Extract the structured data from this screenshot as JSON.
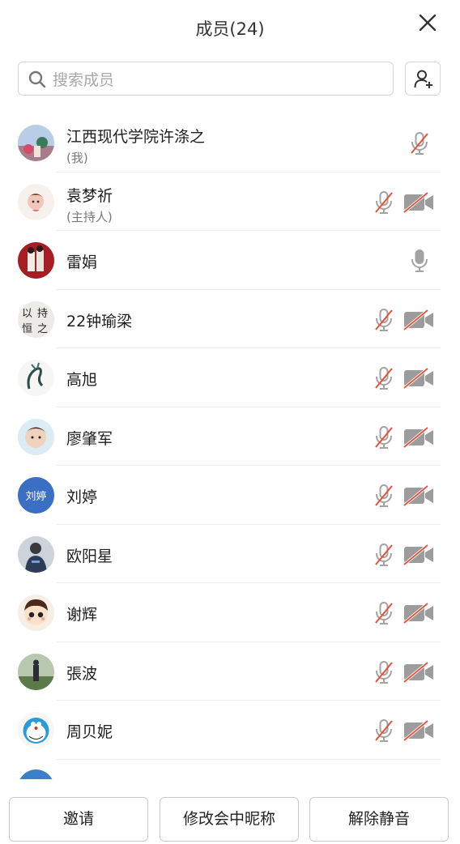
{
  "header": {
    "title": "成员(24)"
  },
  "search": {
    "placeholder": "搜索成员"
  },
  "members": [
    {
      "name": "江西现代学院许涤之",
      "sub": "(我)",
      "mic": "muted",
      "cam": "none",
      "avatar": "photo-festival"
    },
    {
      "name": "袁梦祈",
      "sub": "(主持人)",
      "mic": "muted",
      "cam": "off",
      "avatar": "photo-doll"
    },
    {
      "name": "雷娟",
      "sub": "",
      "mic": "on",
      "cam": "none",
      "avatar": "photo-red"
    },
    {
      "name": "22钟瑜梁",
      "sub": "",
      "mic": "muted",
      "cam": "off",
      "avatar": "calligraphy",
      "avatar_text": [
        "以",
        "持",
        "恒",
        "之"
      ]
    },
    {
      "name": "高旭",
      "sub": "",
      "mic": "muted",
      "cam": "off",
      "avatar": "ink-dragon"
    },
    {
      "name": "廖肇军",
      "sub": "",
      "mic": "muted",
      "cam": "off",
      "avatar": "photo-child"
    },
    {
      "name": "刘婷",
      "sub": "",
      "mic": "muted",
      "cam": "off",
      "avatar": "text",
      "avatar_text": "刘婷"
    },
    {
      "name": "欧阳星",
      "sub": "",
      "mic": "muted",
      "cam": "off",
      "avatar": "photo-person"
    },
    {
      "name": "谢辉",
      "sub": "",
      "mic": "muted",
      "cam": "off",
      "avatar": "cartoon-boy"
    },
    {
      "name": "張波",
      "sub": "",
      "mic": "muted",
      "cam": "off",
      "avatar": "photo-outdoor"
    },
    {
      "name": "周贝妮",
      "sub": "",
      "mic": "muted",
      "cam": "off",
      "avatar": "doraemon"
    }
  ],
  "footer": {
    "invite": "邀请",
    "rename": "修改会中昵称",
    "unmute": "解除静音"
  },
  "colors": {
    "muted_slash": "#e8503a",
    "icon_gray": "#9a9a9a",
    "avatar_blue": "#3a6fc4"
  }
}
